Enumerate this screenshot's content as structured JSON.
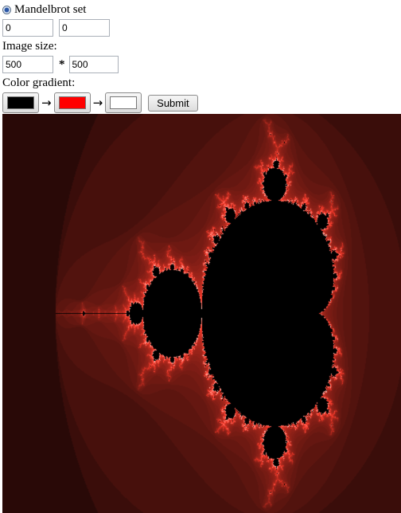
{
  "mode": {
    "label": "Mandelbrot set",
    "selected": true
  },
  "coords": {
    "x_value": "0",
    "y_value": "0"
  },
  "image_size": {
    "label": "Image size:",
    "width": "500",
    "times": "*",
    "height": "500"
  },
  "gradient": {
    "label": "Color gradient:",
    "arrow": "→",
    "colors": [
      "#000000",
      "#ff0000",
      "#ffffff"
    ]
  },
  "submit_label": "Submit",
  "fractal": {
    "background": "#050101",
    "edge_color": "#ff3a2a",
    "glow_color": "#ffd0c8"
  }
}
